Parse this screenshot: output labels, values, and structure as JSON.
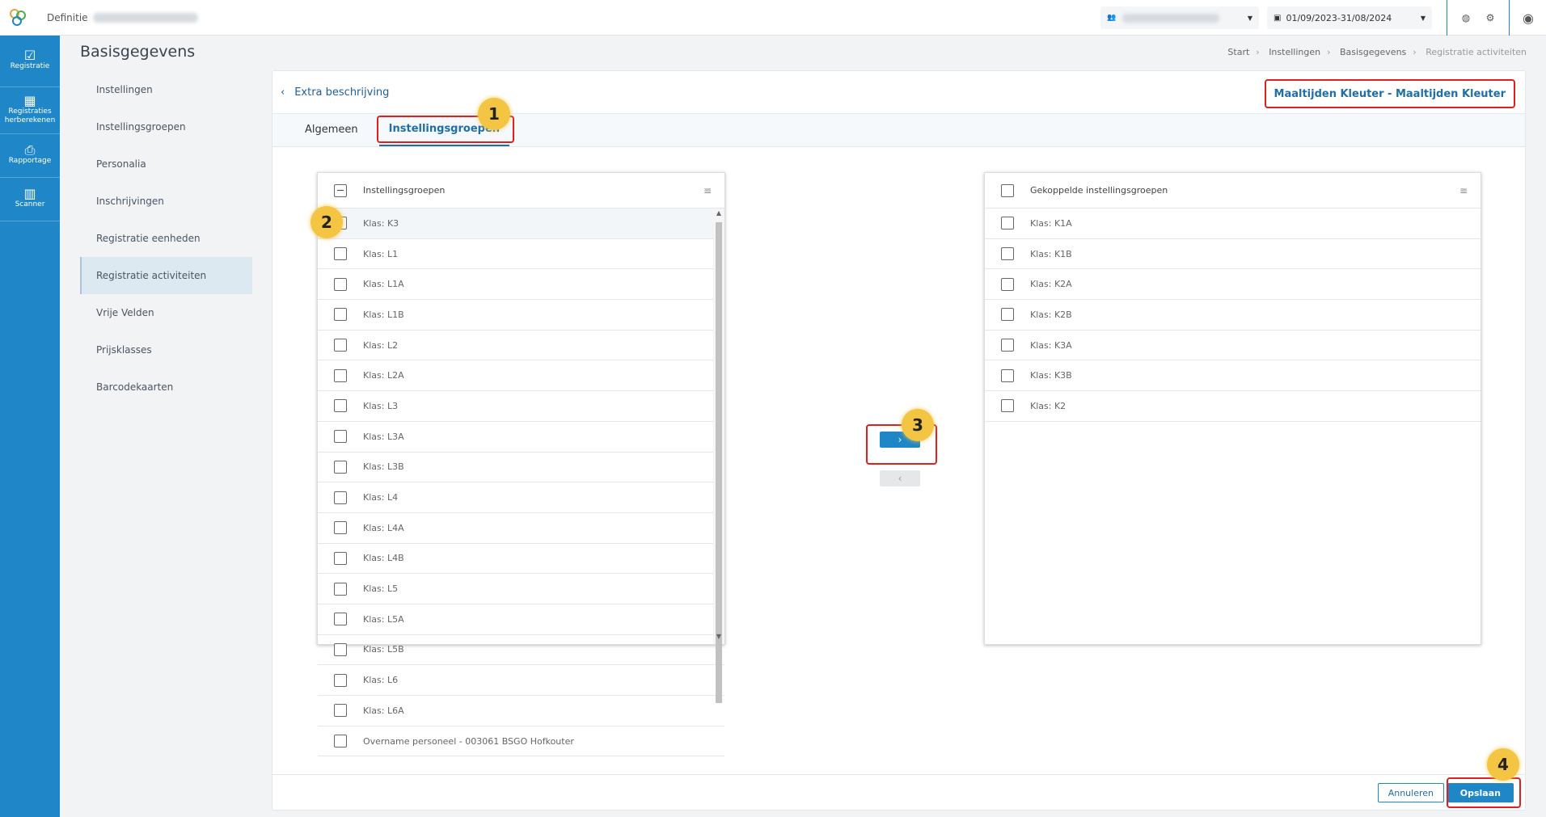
{
  "topbar": {
    "app_title": "Definitie",
    "user_select_value": "",
    "period_value": "01/09/2023-31/08/2024"
  },
  "sidebar": {
    "items": [
      {
        "label": "Registratie",
        "icon": "calendar-check-icon"
      },
      {
        "label": "Registraties herberekenen",
        "icon": "calculator-icon"
      },
      {
        "label": "Rapportage",
        "icon": "printer-icon"
      },
      {
        "label": "Scanner",
        "icon": "barcode-icon"
      }
    ]
  },
  "page": {
    "title": "Basisgegevens",
    "breadcrumb": [
      "Start",
      "Instellingen",
      "Basisgegevens",
      "Registratie activiteiten"
    ]
  },
  "subnav": {
    "items": [
      "Instellingen",
      "Instellingsgroepen",
      "Personalia",
      "Inschrijvingen",
      "Registratie eenheden",
      "Registratie activiteiten",
      "Vrije Velden",
      "Prijsklasses",
      "Barcodekaarten"
    ],
    "active_index": 5
  },
  "card": {
    "back_title": "Extra beschrijving",
    "header_right": "Maaltijden Kleuter - Maaltijden Kleuter",
    "tabs": [
      "Algemeen",
      "Instellingsgroepen"
    ],
    "active_tab": 1
  },
  "left_list": {
    "header": "Instellingsgroepen",
    "items": [
      "Klas: K3",
      "Klas: L1",
      "Klas: L1A",
      "Klas: L1B",
      "Klas: L2",
      "Klas: L2A",
      "Klas: L3",
      "Klas: L3A",
      "Klas: L3B",
      "Klas: L4",
      "Klas: L4A",
      "Klas: L4B",
      "Klas: L5",
      "Klas: L5A",
      "Klas: L5B",
      "Klas: L6",
      "Klas: L6A",
      "Overname personeel - 003061 BSGO Hofkouter"
    ]
  },
  "right_list": {
    "header": "Gekoppelde instellingsgroepen",
    "items": [
      "Klas: K1A",
      "Klas: K1B",
      "Klas: K2A",
      "Klas: K2B",
      "Klas: K3A",
      "Klas: K3B",
      "Klas: K2"
    ]
  },
  "buttons": {
    "move_right": "›",
    "move_left": "‹",
    "cancel": "Annuleren",
    "save": "Opslaan"
  },
  "badges": [
    "1",
    "2",
    "3",
    "4"
  ],
  "colors": {
    "accent": "#1f86c7",
    "highlight": "#e02020",
    "badge": "#f4c542"
  }
}
